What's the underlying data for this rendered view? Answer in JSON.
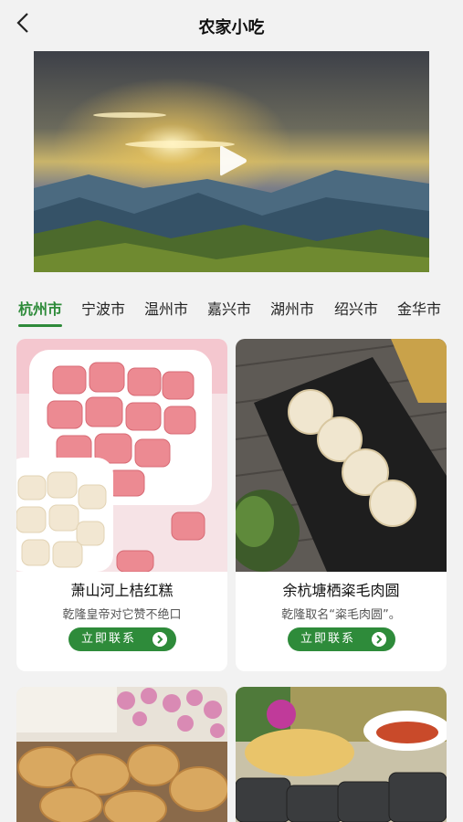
{
  "header": {
    "back_icon": "chevron-left-icon",
    "title": "农家小吃"
  },
  "video": {
    "play_icon": "play-icon"
  },
  "tabs": [
    {
      "label": "杭州市",
      "active": true
    },
    {
      "label": "宁波市",
      "active": false
    },
    {
      "label": "温州市",
      "active": false
    },
    {
      "label": "嘉兴市",
      "active": false
    },
    {
      "label": "湖州市",
      "active": false
    },
    {
      "label": "绍兴市",
      "active": false
    },
    {
      "label": "金华市",
      "active": false
    }
  ],
  "cards": [
    {
      "name": "萧山河上桔红糕",
      "desc": "乾隆皇帝对它赞不绝口",
      "button": "立即联系"
    },
    {
      "name": "余杭塘栖粢毛肉圆",
      "desc": "乾隆取名“粢毛肉圆”。",
      "button": "立即联系"
    },
    {
      "name": "",
      "desc": "",
      "button": ""
    },
    {
      "name": "",
      "desc": "",
      "button": ""
    }
  ],
  "colors": {
    "accent": "#2e8b3a",
    "background": "#f2f2f2"
  }
}
